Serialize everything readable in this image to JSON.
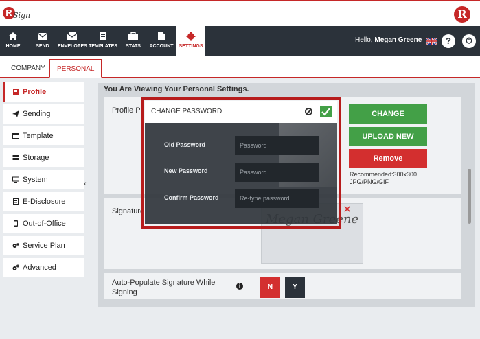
{
  "header": {
    "logo_text": "R",
    "logo_script": "Sign",
    "brand_letter": "R"
  },
  "nav": {
    "items": [
      {
        "label": "HOME",
        "icon": "home-icon"
      },
      {
        "label": "SEND",
        "icon": "envelope-icon"
      },
      {
        "label": "ENVELOPES",
        "icon": "envelopes-icon"
      },
      {
        "label": "TEMPLATES",
        "icon": "template-icon"
      },
      {
        "label": "STATS",
        "icon": "briefcase-icon"
      },
      {
        "label": "ACCOUNT",
        "icon": "account-icon"
      },
      {
        "label": "SETTINGS",
        "icon": "gear-icon"
      }
    ],
    "hello_prefix": "Hello,",
    "user_name": "Megan Greene",
    "help_label": "?",
    "power_label": "⏻"
  },
  "tabs": [
    {
      "label": "COMPANY"
    },
    {
      "label": "PERSONAL"
    }
  ],
  "sidebar": {
    "items": [
      {
        "label": "Profile"
      },
      {
        "label": "Sending"
      },
      {
        "label": "Template"
      },
      {
        "label": "Storage"
      },
      {
        "label": "System"
      },
      {
        "label": "E-Disclosure"
      },
      {
        "label": "Out-of-Office"
      },
      {
        "label": "Service Plan"
      },
      {
        "label": "Advanced"
      }
    ],
    "collapse_label": "‹"
  },
  "main": {
    "viewing_text": "You Are Viewing Your Personal Settings.",
    "profile_label": "Profile Pi",
    "signature_label": "Signature",
    "change_password_button": "CHANGE PASSWORD",
    "upload_new_button": "UPLOAD NEW",
    "remove_button": "Remove",
    "recommended_line1": "Recommended:300x300",
    "recommended_line2": "JPG/PNG/GIF",
    "signature_text": "Megan Greene",
    "signature_remove": "✕",
    "auto_populate_line1": "Auto-Populate Signature While",
    "auto_populate_line2": "Signing",
    "info_label": "i",
    "toggle_no": "N",
    "toggle_yes": "Y"
  },
  "modal": {
    "title": "CHANGE PASSWORD",
    "old_password_label": "Old Password",
    "old_password_placeholder": "Password",
    "new_password_label": "New Password",
    "new_password_placeholder": "Password",
    "confirm_password_label": "Confirm Password",
    "confirm_password_placeholder": "Re-type password"
  },
  "colors": {
    "accent": "#c62828",
    "nav_bg": "#2b323a",
    "green": "#43a047",
    "red": "#d32f2f"
  }
}
